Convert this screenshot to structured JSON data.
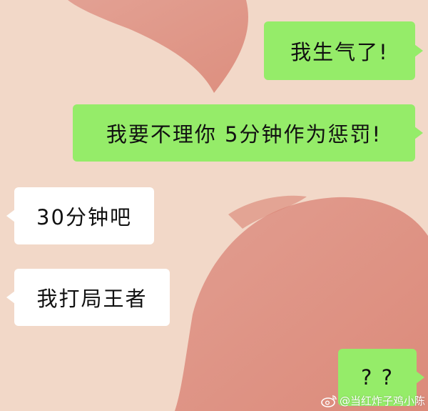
{
  "chat": {
    "messages": [
      {
        "text": "我生气了!",
        "sender": "me"
      },
      {
        "text": "我要不理你 5分钟作为惩罚!",
        "sender": "me"
      },
      {
        "text": "30分钟吧",
        "sender": "other"
      },
      {
        "text": "我打局王者",
        "sender": "other"
      },
      {
        "text": "? ?",
        "sender": "me"
      }
    ]
  },
  "watermark": {
    "text": "@当红炸子鸡小陈",
    "icon": "weibo-icon"
  },
  "colors": {
    "background": "#f2d8c8",
    "sent_bubble": "#95ec69",
    "received_bubble": "#ffffff",
    "heart_shape": "#dc8a7a"
  }
}
